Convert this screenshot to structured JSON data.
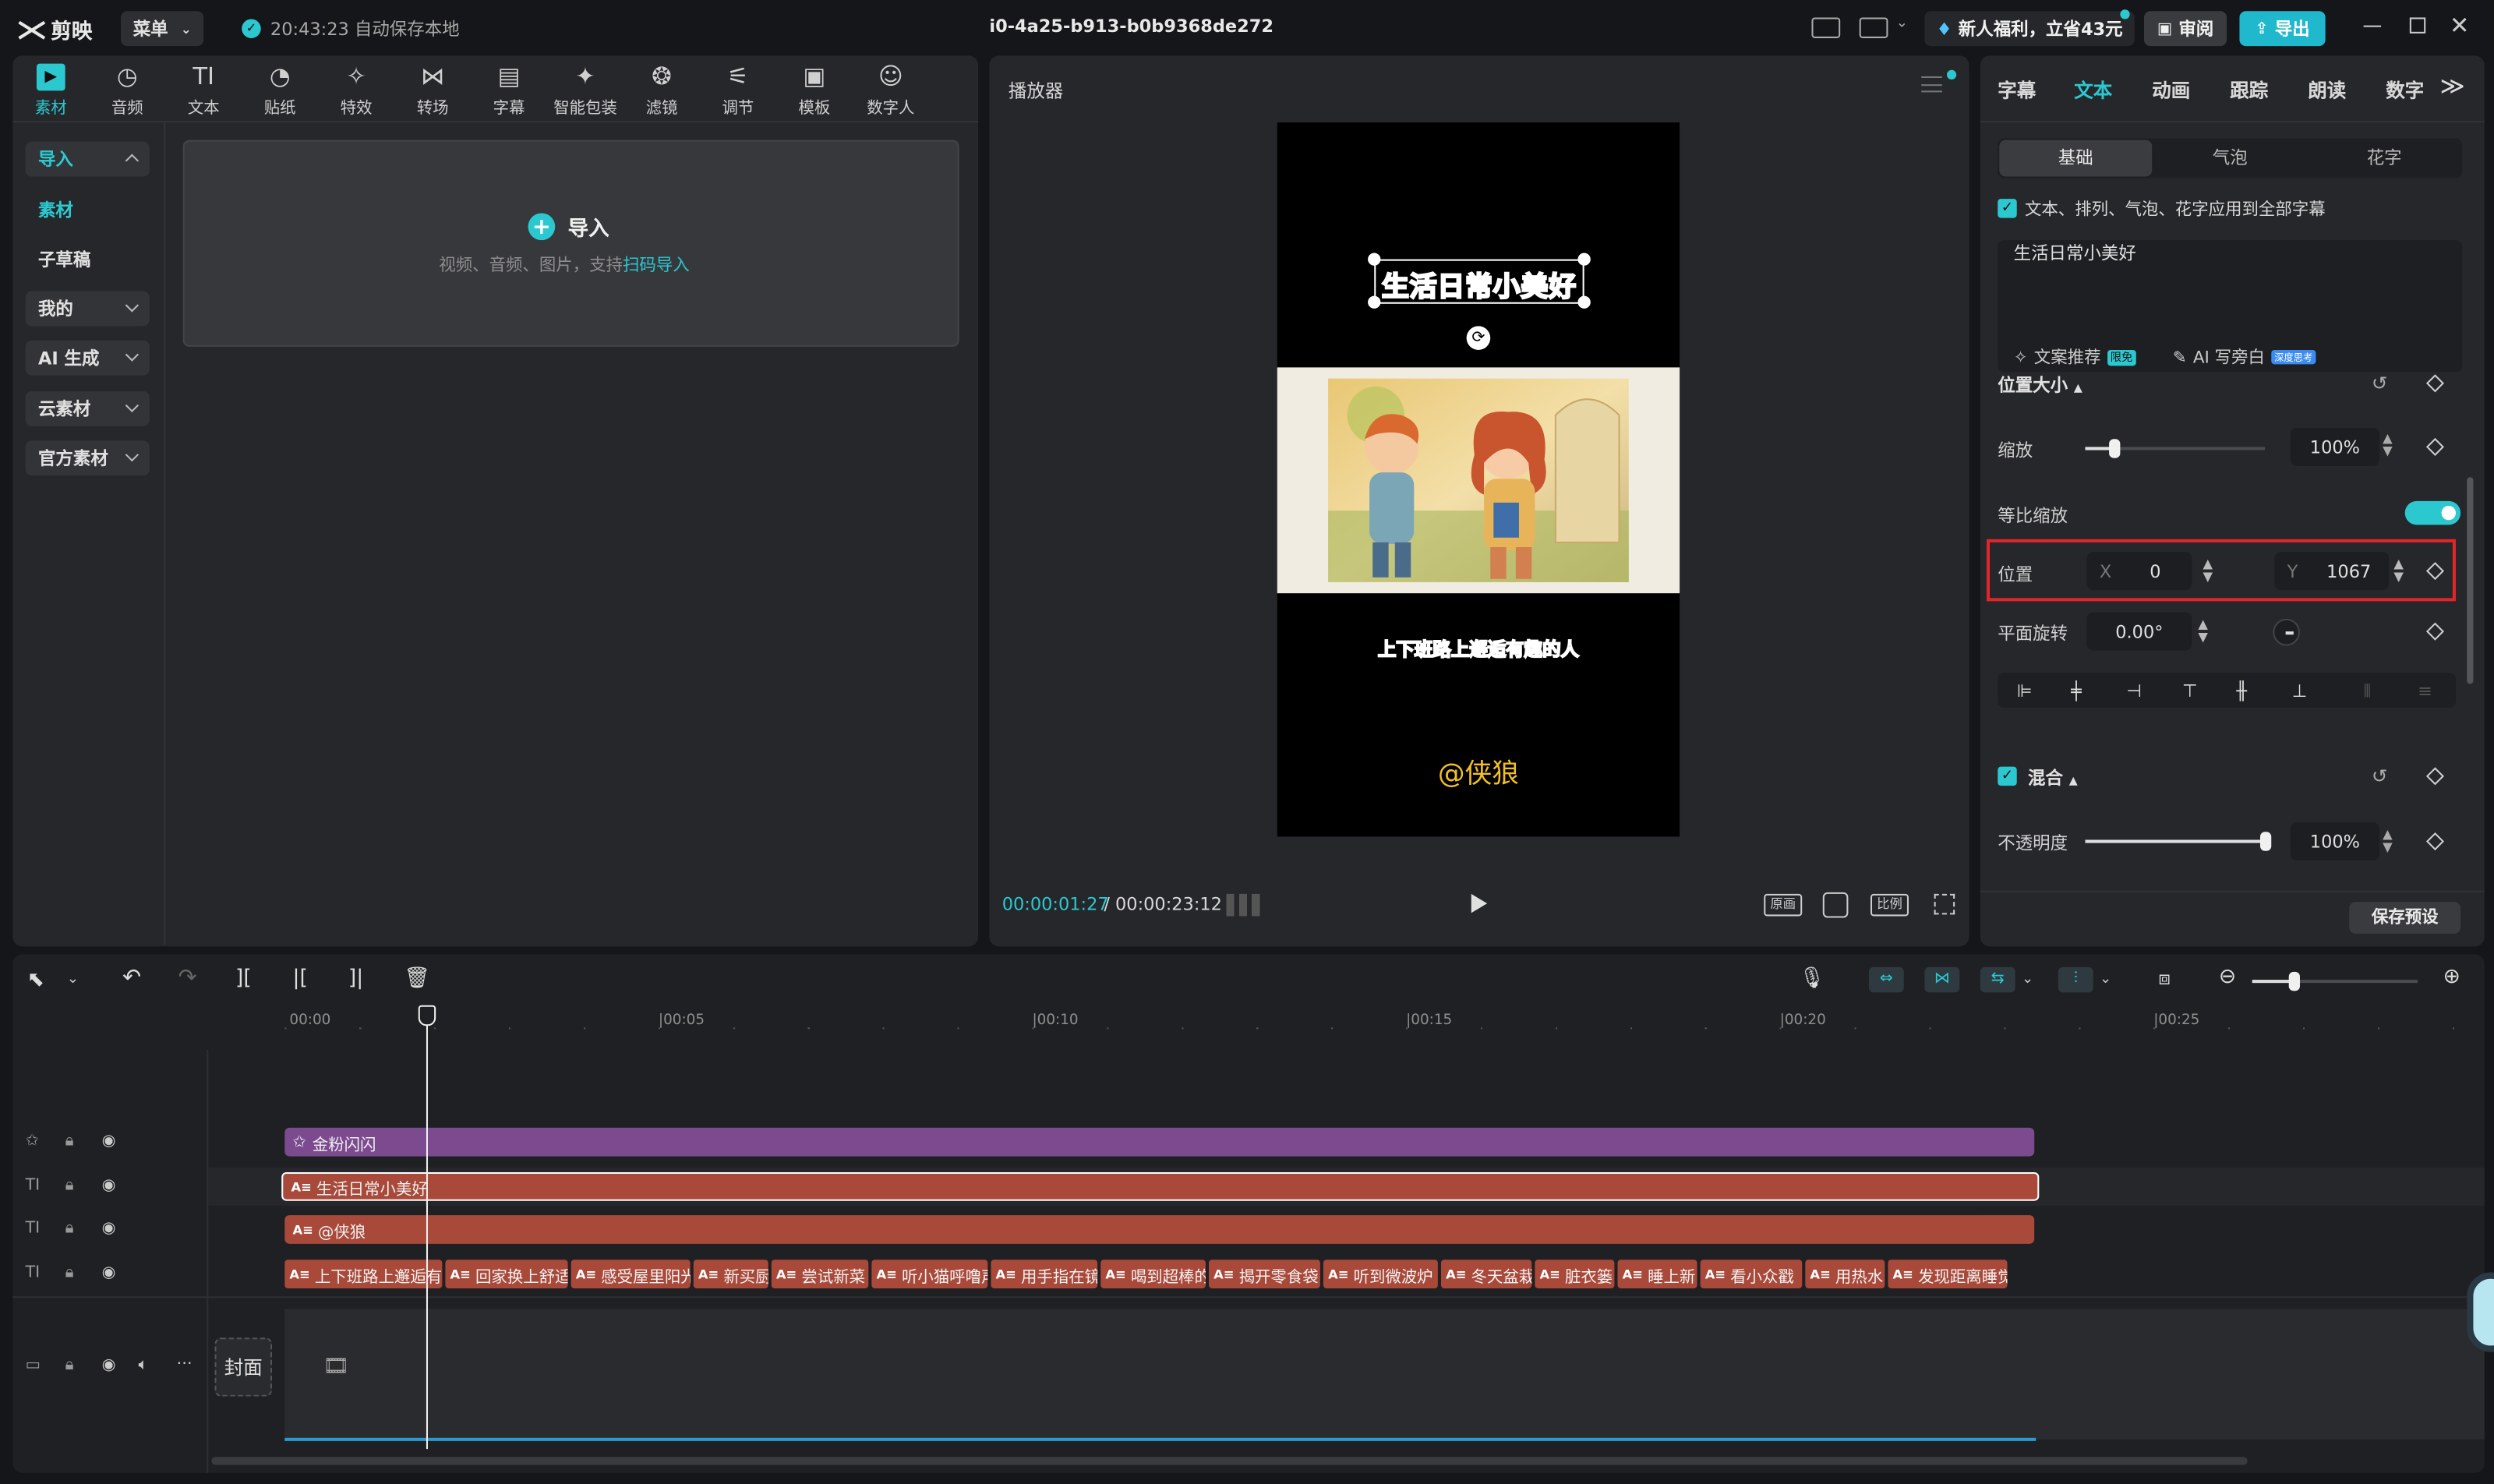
{
  "app": {
    "logo": "剪映",
    "menu_label": "菜单",
    "autosave": "20:43:23 自动保存本地",
    "project_title": "i0-4a25-b913-b0b9368de272",
    "promo": "新人福利，立省43元",
    "review_label": "审阅",
    "export_label": "导出"
  },
  "tools": [
    {
      "label": "素材",
      "icon": "media-icon"
    },
    {
      "label": "音频",
      "icon": "audio-icon"
    },
    {
      "label": "文本",
      "icon": "text-icon"
    },
    {
      "label": "贴纸",
      "icon": "sticker-icon"
    },
    {
      "label": "特效",
      "icon": "effects-icon"
    },
    {
      "label": "转场",
      "icon": "transition-icon"
    },
    {
      "label": "字幕",
      "icon": "caption-icon"
    },
    {
      "label": "智能包装",
      "icon": "smart-pack-icon"
    },
    {
      "label": "滤镜",
      "icon": "filter-icon"
    },
    {
      "label": "调节",
      "icon": "adjust-icon"
    },
    {
      "label": "模板",
      "icon": "template-icon"
    },
    {
      "label": "数字人",
      "icon": "digital-human-icon"
    }
  ],
  "left_nav": [
    {
      "label": "导入"
    },
    {
      "label": "素材"
    },
    {
      "label": "子草稿"
    },
    {
      "label": "我的"
    },
    {
      "label": "AI 生成"
    },
    {
      "label": "云素材"
    },
    {
      "label": "官方素材"
    }
  ],
  "import_box": {
    "title": "导入",
    "hint": "视频、音频、图片，支持",
    "link": "扫码导入"
  },
  "player": {
    "title": "播放器",
    "caption_top": "生活日常小美好",
    "caption_bottom": "上下班路上邂逅有趣的人",
    "watermark": "@侠狼",
    "current_time": "00:00:01:27",
    "total_time": "00:00:23:12",
    "btn_original": "原画",
    "btn_ratio": "比例"
  },
  "right_panel": {
    "tabs": [
      "字幕",
      "文本",
      "动画",
      "跟踪",
      "朗读",
      "数字"
    ],
    "active_tab": "文本",
    "subtabs": [
      "基础",
      "气泡",
      "花字"
    ],
    "apply_all": "文本、排列、气泡、花字应用到全部字幕",
    "text_value": "生活日常小美好",
    "ai_copy": "文案推荐",
    "ai_copy_badge": "限免",
    "ai_write": "AI 写旁白",
    "ai_write_badge": "深度思考",
    "section_position": "位置大小",
    "scale_label": "缩放",
    "scale_value": "100%",
    "scale_level": 0.16,
    "uniform_label": "等比缩放",
    "position_label": "位置",
    "x_label": "X",
    "x_value": "0",
    "y_label": "Y",
    "y_value": "1067",
    "rotate_label": "平面旋转",
    "rotate_value": "0.00°",
    "blend_label": "混合",
    "opacity_label": "不透明度",
    "opacity_value": "100%",
    "opacity_level": 1.0,
    "save_preset": "保存预设",
    "highlight_color": "#e0252b"
  },
  "timeline": {
    "ticks": [
      "00:00",
      "|00:05",
      "|00:10",
      "|00:15",
      "|00:20",
      "|00:25"
    ],
    "track_effect": "金粉闪闪",
    "track_text1": "生活日常小美好",
    "track_text2": "@侠狼",
    "subtitles": [
      "上下班路上邂逅有",
      "回家换上舒适",
      "感受屋里阳光",
      "新买厨",
      "尝试新菜",
      "听小猫呼噜声",
      "用手指在镜",
      "喝到超棒的",
      "揭开零食袋",
      "听到微波炉",
      "冬天盆栽",
      "脏衣篓",
      "睡上新",
      "看小众戳",
      "用热水",
      "发现距离睡觉"
    ],
    "cover_label": "封面"
  },
  "colors": {
    "accent": "#2cc8d0",
    "effect_clip": "#7b4a8f",
    "text_clip": "#a9493a"
  }
}
